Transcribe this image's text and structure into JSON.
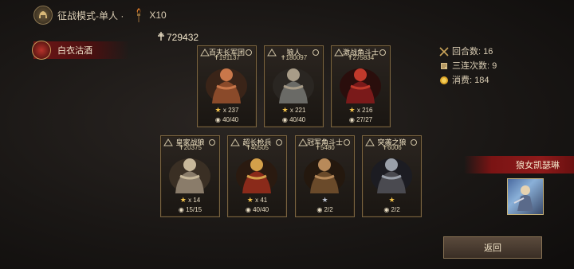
{
  "topbar": {
    "mode_title": "征战模式-单人 ·",
    "torch_count": "X10"
  },
  "player": {
    "name": "白衣沽酒"
  },
  "power_total": "729432",
  "stats": [
    {
      "label": "回合数",
      "value": "16",
      "text": "回合数: 16",
      "icon": "crossed-swords-icon"
    },
    {
      "label": "三连次数",
      "value": "9",
      "text": "三连次数: 9",
      "icon": "scroll-icon"
    },
    {
      "label": "消费",
      "value": "184",
      "text": "消费: 184",
      "icon": "gold-coin-icon"
    }
  ],
  "units": [
    {
      "name": "百夫长军团",
      "power": "191137",
      "stars": "x 237",
      "star_color": "gold",
      "hp": "40/40",
      "palette": [
        "#8a4a2a",
        "#c9774a",
        "#3a2418"
      ]
    },
    {
      "name": "狼人",
      "power": "180097",
      "stars": "x 221",
      "star_color": "gold",
      "hp": "40/40",
      "palette": [
        "#6a6a66",
        "#a89c88",
        "#2a2622"
      ]
    },
    {
      "name": "激战角斗士",
      "power": "275834",
      "stars": "x 216",
      "star_color": "gold",
      "hp": "27/27",
      "palette": [
        "#7a1a1a",
        "#c0392b",
        "#2a0e0c"
      ]
    },
    {
      "name": "皇家战狼",
      "power": "20375",
      "stars": "x 14",
      "star_color": "gold",
      "hp": "15/15",
      "palette": [
        "#8a7c6a",
        "#c8b89a",
        "#3a2f24"
      ]
    },
    {
      "name": "超长枪兵",
      "power": "40505",
      "stars": "x 41",
      "star_color": "gold",
      "hp": "40/40",
      "palette": [
        "#8a2a1a",
        "#d4a04a",
        "#2a1a10"
      ]
    },
    {
      "name": "冠军角斗士",
      "power": "5480",
      "stars": "",
      "star_color": "silver",
      "hp": "2/2",
      "palette": [
        "#6a4a2a",
        "#b88a5a",
        "#24180e"
      ]
    },
    {
      "name": "突袭之狼",
      "power": "6006",
      "stars": "",
      "star_color": "gold",
      "hp": "2/2",
      "palette": [
        "#4a4a50",
        "#9aa0aa",
        "#1c1c22"
      ]
    }
  ],
  "hero": {
    "name": "狼女凯瑟琳"
  },
  "buttons": {
    "back": "返回"
  }
}
